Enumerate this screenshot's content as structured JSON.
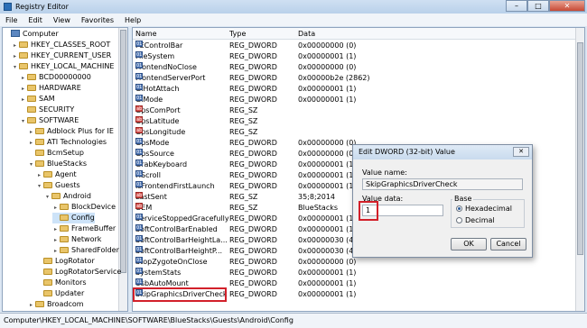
{
  "window": {
    "title": "Registry Editor"
  },
  "menu": [
    "File",
    "Edit",
    "View",
    "Favorites",
    "Help"
  ],
  "tree": [
    {
      "label": "Computer",
      "indent": 0,
      "toggle": "",
      "icon": "computer-icon"
    },
    {
      "label": "HKEY_CLASSES_ROOT",
      "indent": 1,
      "toggle": "▸",
      "icon": "folder-icon"
    },
    {
      "label": "HKEY_CURRENT_USER",
      "indent": 1,
      "toggle": "▸",
      "icon": "folder-icon"
    },
    {
      "label": "HKEY_LOCAL_MACHINE",
      "indent": 1,
      "toggle": "▾",
      "icon": "folder-icon"
    },
    {
      "label": "BCD00000000",
      "indent": 2,
      "toggle": "▸",
      "icon": "folder-icon"
    },
    {
      "label": "HARDWARE",
      "indent": 2,
      "toggle": "▸",
      "icon": "folder-icon"
    },
    {
      "label": "SAM",
      "indent": 2,
      "toggle": "▸",
      "icon": "folder-icon"
    },
    {
      "label": "SECURITY",
      "indent": 2,
      "toggle": "",
      "icon": "folder-icon"
    },
    {
      "label": "SOFTWARE",
      "indent": 2,
      "toggle": "▾",
      "icon": "folder-icon"
    },
    {
      "label": "Adblock Plus for IE",
      "indent": 3,
      "toggle": "▸",
      "icon": "folder-icon"
    },
    {
      "label": "ATI Technologies",
      "indent": 3,
      "toggle": "▸",
      "icon": "folder-icon"
    },
    {
      "label": "BcmSetup",
      "indent": 3,
      "toggle": "",
      "icon": "folder-icon"
    },
    {
      "label": "BlueStacks",
      "indent": 3,
      "toggle": "▾",
      "icon": "folder-icon"
    },
    {
      "label": "Agent",
      "indent": 4,
      "toggle": "▸",
      "icon": "folder-icon"
    },
    {
      "label": "Guests",
      "indent": 4,
      "toggle": "▾",
      "icon": "folder-icon"
    },
    {
      "label": "Android",
      "indent": 5,
      "toggle": "▾",
      "icon": "folder-icon"
    },
    {
      "label": "BlockDevice",
      "indent": 6,
      "toggle": "▸",
      "icon": "folder-icon"
    },
    {
      "label": "Config",
      "indent": 6,
      "toggle": "",
      "icon": "folder-icon",
      "selected": true
    },
    {
      "label": "FrameBuffer",
      "indent": 6,
      "toggle": "▸",
      "icon": "folder-icon"
    },
    {
      "label": "Network",
      "indent": 6,
      "toggle": "▸",
      "icon": "folder-icon"
    },
    {
      "label": "SharedFolder",
      "indent": 6,
      "toggle": "▸",
      "icon": "folder-icon"
    },
    {
      "label": "LogRotator",
      "indent": 4,
      "toggle": "",
      "icon": "folder-icon"
    },
    {
      "label": "LogRotatorService",
      "indent": 4,
      "toggle": "",
      "icon": "folder-icon"
    },
    {
      "label": "Monitors",
      "indent": 4,
      "toggle": "",
      "icon": "folder-icon"
    },
    {
      "label": "Updater",
      "indent": 4,
      "toggle": "",
      "icon": "folder-icon"
    },
    {
      "label": "Broadcom",
      "indent": 3,
      "toggle": "▸",
      "icon": "folder-icon"
    }
  ],
  "columns": {
    "name": "Name",
    "type": "Type",
    "data": "Data"
  },
  "values": [
    {
      "name": "FEControlBar",
      "type": "REG_DWORD",
      "data": "0x00000000 (0)",
      "kind": "dword"
    },
    {
      "name": "FileSystem",
      "type": "REG_DWORD",
      "data": "0x00000001 (1)",
      "kind": "dword"
    },
    {
      "name": "FrontendNoClose",
      "type": "REG_DWORD",
      "data": "0x00000000 (0)",
      "kind": "dword"
    },
    {
      "name": "FrontendServerPort",
      "type": "REG_DWORD",
      "data": "0x00000b2e (2862)",
      "kind": "dword"
    },
    {
      "name": "GlHotAttach",
      "type": "REG_DWORD",
      "data": "0x00000001 (1)",
      "kind": "dword"
    },
    {
      "name": "GlMode",
      "type": "REG_DWORD",
      "data": "0x00000001 (1)",
      "kind": "dword"
    },
    {
      "name": "GpsComPort",
      "type": "REG_SZ",
      "data": "",
      "kind": "sz"
    },
    {
      "name": "GpsLatitude",
      "type": "REG_SZ",
      "data": "",
      "kind": "sz"
    },
    {
      "name": "GpsLongitude",
      "type": "REG_SZ",
      "data": "",
      "kind": "sz"
    },
    {
      "name": "GpsMode",
      "type": "REG_DWORD",
      "data": "0x00000000 (0)",
      "kind": "dword"
    },
    {
      "name": "GpsSource",
      "type": "REG_DWORD",
      "data": "0x00000000 (0)",
      "kind": "dword"
    },
    {
      "name": "GrabKeyboard",
      "type": "REG_DWORD",
      "data": "0x00000001 (1)",
      "kind": "dword"
    },
    {
      "name": "HScroll",
      "type": "REG_DWORD",
      "data": "0x00000001 (1)",
      "kind": "dword"
    },
    {
      "name": "IsFrontendFirstLaunch",
      "type": "REG_DWORD",
      "data": "0x00000001 (1)",
      "kind": "dword"
    },
    {
      "name": "LastSent",
      "type": "REG_SZ",
      "data": "35;8;2014",
      "kind": "sz"
    },
    {
      "name": "OEM",
      "type": "REG_SZ",
      "data": "BlueStacks",
      "kind": "sz"
    },
    {
      "name": "ServiceStoppedGracefully",
      "type": "REG_DWORD",
      "data": "0x00000001 (1)",
      "kind": "dword"
    },
    {
      "name": "SoftControlBarEnabled",
      "type": "REG_DWORD",
      "data": "0x00000001 (1)",
      "kind": "dword"
    },
    {
      "name": "SoftControlBarHeightLa...",
      "type": "REG_DWORD",
      "data": "0x00000030 (48)",
      "kind": "dword"
    },
    {
      "name": "SoftControlBarHeightP...",
      "type": "REG_DWORD",
      "data": "0x00000030 (48)",
      "kind": "dword"
    },
    {
      "name": "StopZygoteOnClose",
      "type": "REG_DWORD",
      "data": "0x00000000 (0)",
      "kind": "dword"
    },
    {
      "name": "SystemStats",
      "type": "REG_DWORD",
      "data": "0x00000001 (1)",
      "kind": "dword"
    },
    {
      "name": "UsbAutoMount",
      "type": "REG_DWORD",
      "data": "0x00000001 (1)",
      "kind": "dword"
    },
    {
      "name": "SkipGraphicsDriverCheck",
      "type": "REG_DWORD",
      "data": "0x00000001 (1)",
      "kind": "dword",
      "highlighted": true
    }
  ],
  "status": "Computer\\HKEY_LOCAL_MACHINE\\SOFTWARE\\BlueStacks\\Guests\\Android\\Config",
  "dialog": {
    "title": "Edit DWORD (32-bit) Value",
    "value_name_label": "Value name:",
    "value_name": "SkipGraphicsDriverCheck",
    "value_data_label": "Value data:",
    "value_data": "1",
    "base_label": "Base",
    "hex_label": "Hexadecimal",
    "dec_label": "Decimal",
    "base_selected": "Hexadecimal",
    "ok_label": "OK",
    "cancel_label": "Cancel"
  },
  "colors": {
    "highlight": "#d2202a",
    "selection": "#cde3f8"
  }
}
